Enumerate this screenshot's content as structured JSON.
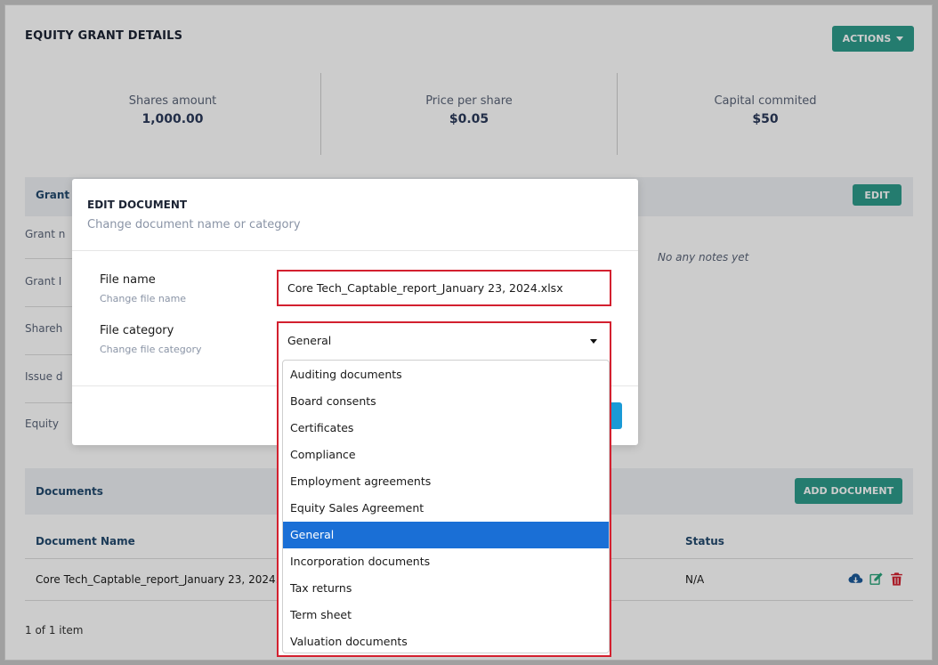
{
  "page": {
    "title": "EQUITY GRANT DETAILS",
    "actions_label": "ACTIONS"
  },
  "stats": [
    {
      "label": "Shares amount",
      "value": "1,000.00"
    },
    {
      "label": "Price per share",
      "value": "$0.05"
    },
    {
      "label": "Capital commited",
      "value": "$50"
    }
  ],
  "grant_section": {
    "title_partial": "Grant d",
    "edit_label": "EDIT",
    "rows_partial": [
      "Grant n",
      "Grant I",
      "Shareh",
      "Issue d",
      "Equity"
    ],
    "notes_empty": "No any notes yet"
  },
  "documents": {
    "title": "Documents",
    "add_label": "ADD DOCUMENT",
    "columns": [
      "Document Name",
      "Status"
    ],
    "rows": [
      {
        "name": "Core Tech_Captable_report_January 23, 2024.xlsx",
        "status": "N/A"
      }
    ],
    "pager": "1 of 1 item"
  },
  "modal": {
    "title": "EDIT DOCUMENT",
    "subtitle": "Change document name or category",
    "file_name_label": "File name",
    "file_name_help": "Change file name",
    "file_name_value": "Core Tech_Captable_report_January 23, 2024.xlsx",
    "file_category_label": "File category",
    "file_category_help": "Change file category",
    "file_category_value": "General",
    "category_options": [
      "Auditing documents",
      "Board consents",
      "Certificates",
      "Compliance",
      "Employment agreements",
      "Equity Sales Agreement",
      "General",
      "Incorporation documents",
      "Tax returns",
      "Term sheet",
      "Valuation documents"
    ],
    "selected_option": "General"
  },
  "icons": {
    "download": "cloud-download-icon",
    "edit": "edit-icon",
    "delete": "trash-icon"
  },
  "colors": {
    "accent_teal": "#2e9b8b",
    "highlight_red": "#d3202f",
    "selected_blue": "#1a6fd6"
  }
}
